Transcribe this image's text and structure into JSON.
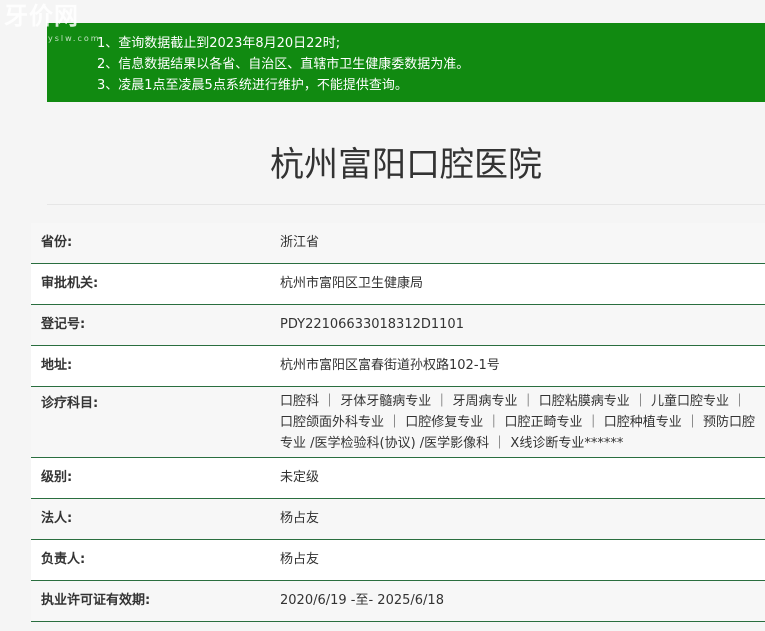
{
  "watermark": {
    "text": "牙价网",
    "sub": "yslw.com"
  },
  "notice": {
    "lines": [
      "1、查询数据截止到2023年8月20日22时;",
      "2、信息数据结果以各省、自治区、直辖市卫生健康委数据为准。",
      "3、凌晨1点至凌晨5点系统进行维护，不能提供查询。"
    ]
  },
  "hospital": {
    "title": "杭州富阳口腔医院",
    "rows": [
      {
        "label": "省份:",
        "value": "浙江省"
      },
      {
        "label": "审批机关:",
        "value": "杭州市富阳区卫生健康局"
      },
      {
        "label": "登记号:",
        "value": "PDY22106633018312D1101"
      },
      {
        "label": "地址:",
        "value": "杭州市富阳区富春街道孙权路102-1号"
      },
      {
        "label": "诊疗科目:",
        "value": "口腔科 ｜ 牙体牙髓病专业 ｜ 牙周病专业 ｜ 口腔粘膜病专业 ｜ 儿童口腔专业 ｜ 口腔颌面外科专业 ｜ 口腔修复专业 ｜ 口腔正畸专业 ｜ 口腔种植专业 ｜ 预防口腔专业 /医学检验科(协议) /医学影像科 ｜ X线诊断专业******"
      },
      {
        "label": "级别:",
        "value": "未定级"
      },
      {
        "label": "法人:",
        "value": "杨占友"
      },
      {
        "label": "负责人:",
        "value": "杨占友"
      },
      {
        "label": "执业许可证有效期:",
        "value": "2020/6/19 -至- 2025/6/18"
      }
    ]
  }
}
